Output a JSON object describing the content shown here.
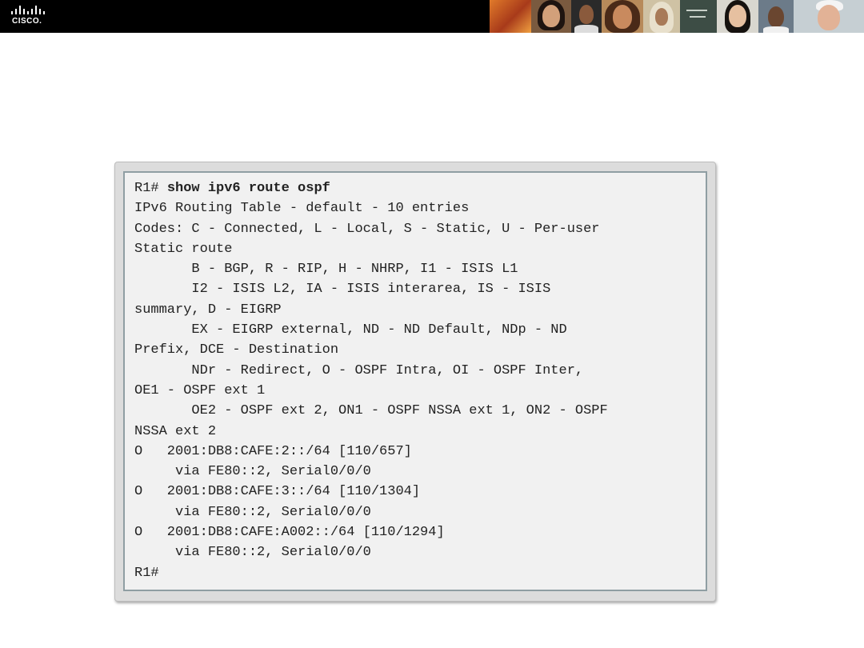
{
  "header": {
    "logo_text": "CISCO.",
    "logo_icon": "cisco-bridge-logo-icon",
    "photos": [
      {
        "icon": "photo-orange-collage",
        "bg": "#c8602a"
      },
      {
        "icon": "photo-woman-smiling",
        "bg": "#7a5a3f"
      },
      {
        "icon": "photo-man-dark",
        "bg": "#2a2a2a"
      },
      {
        "icon": "photo-woman-curly-hair",
        "bg": "#b78a5a"
      },
      {
        "icon": "photo-woman-headscarf",
        "bg": "#cfc2a4"
      },
      {
        "icon": "photo-chalkboard",
        "bg": "#3d4d45"
      },
      {
        "icon": "photo-woman-asian",
        "bg": "#d9d7cf"
      },
      {
        "icon": "photo-man-cap",
        "bg": "#6c7b89"
      },
      {
        "icon": "photo-man-smiling",
        "bg": "#c6cfd3"
      }
    ]
  },
  "terminal": {
    "prompt": "R1#",
    "command": "show ipv6 route ospf",
    "lines": [
      "IPv6 Routing Table - default - 10 entries",
      "Codes: C - Connected, L - Local, S - Static, U - Per-user",
      "Static route",
      "       B - BGP, R - RIP, H - NHRP, I1 - ISIS L1",
      "       I2 - ISIS L2, IA - ISIS interarea, IS - ISIS",
      "summary, D - EIGRP",
      "       EX - EIGRP external, ND - ND Default, NDp - ND",
      "Prefix, DCE - Destination",
      "       NDr - Redirect, O - OSPF Intra, OI - OSPF Inter,",
      "OE1 - OSPF ext 1",
      "       OE2 - OSPF ext 2, ON1 - OSPF NSSA ext 1, ON2 - OSPF",
      "NSSA ext 2",
      "O   2001:DB8:CAFE:2::/64 [110/657]",
      "     via FE80::2, Serial0/0/0",
      "O   2001:DB8:CAFE:3::/64 [110/1304]",
      "     via FE80::2, Serial0/0/0",
      "O   2001:DB8:CAFE:A002::/64 [110/1294]",
      "     via FE80::2, Serial0/0/0"
    ],
    "final_prompt": "R1#"
  }
}
